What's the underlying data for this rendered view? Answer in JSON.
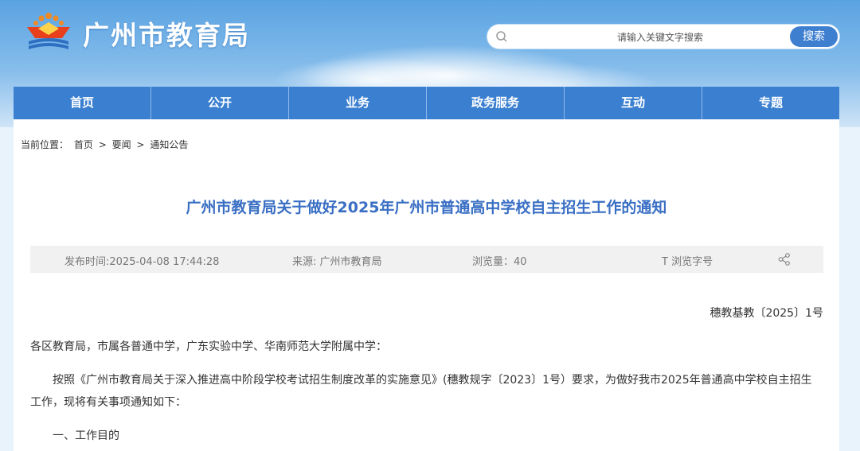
{
  "header": {
    "site_title": "广州市教育局",
    "search_placeholder": "请输入关键文字搜索",
    "search_button": "搜索"
  },
  "nav": {
    "items": [
      {
        "label": "首页"
      },
      {
        "label": "公开"
      },
      {
        "label": "业务"
      },
      {
        "label": "政务服务"
      },
      {
        "label": "互动"
      },
      {
        "label": "专题"
      }
    ]
  },
  "breadcrumb": {
    "prefix": "当前位置：",
    "items": [
      "首页",
      "要闻",
      "通知公告"
    ],
    "separator": ">"
  },
  "article": {
    "title": "广州市教育局关于做好2025年广州市普通高中学校自主招生工作的通知",
    "meta": {
      "publish_time": "发布时间:2025-04-08 17:44:28",
      "source": "来源: 广州市教育局",
      "views": "浏览量：40",
      "font_label": "T  浏览字号"
    },
    "doc_number": "穗教基教〔2025〕1号",
    "paragraphs": [
      "各区教育局，市属各普通中学，广东实验中学、华南师范大学附属中学：",
      "按照《广州市教育局关于深入推进高中阶段学校考试招生制度改革的实施意见》(穗教规字〔2023〕1号）要求，为做好我市2025年普通高中学校自主招生工作，现将有关事项通知如下：",
      "一、工作目的"
    ]
  },
  "colors": {
    "nav_bg": "#3a7fd0",
    "title_color": "#3a6fc4",
    "search_button_bg": "#3f7fd0"
  }
}
